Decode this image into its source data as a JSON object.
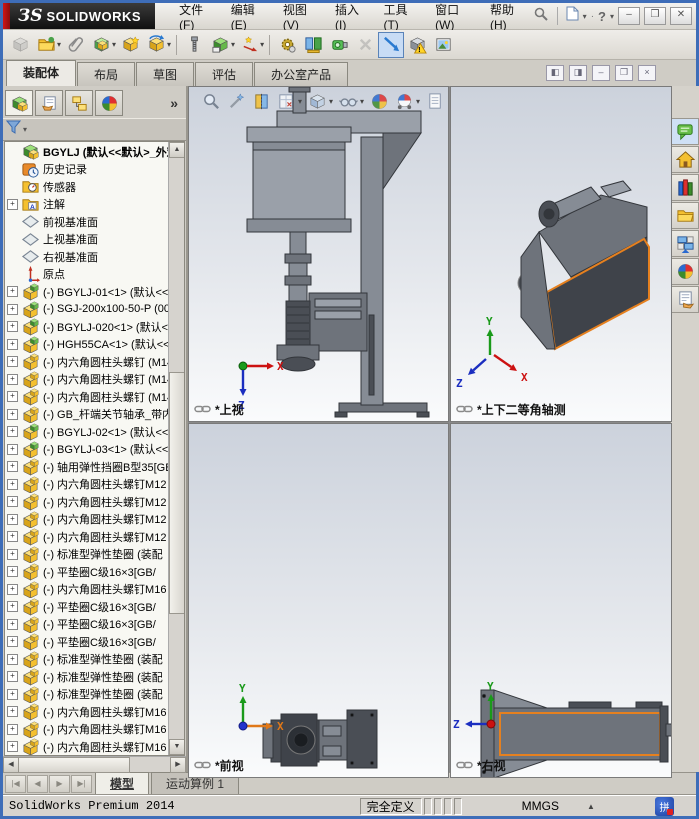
{
  "titlebar": {
    "brand_glyph": "ЗS",
    "brand_name": "SOLIDWORKS",
    "menus": [
      "文件(F)",
      "编辑(E)",
      "视图(V)",
      "插入(I)",
      "工具(T)",
      "窗口(W)",
      "帮助(H)"
    ],
    "window_buttons": {
      "minimize": "–",
      "restore": "❒",
      "close": "✕"
    }
  },
  "toolbar": {
    "items": [
      {
        "name": "insert-component",
        "icon": "cubegray",
        "grayed": true
      },
      {
        "name": "open-document",
        "icon": "folder",
        "dropdown": true
      },
      {
        "name": "attachment",
        "icon": "clip"
      },
      {
        "name": "mate",
        "icon": "pair",
        "dropdown": true
      },
      {
        "name": "insert-components",
        "icon": "starcube"
      },
      {
        "name": "rotate-component",
        "icon": "rotate",
        "dropdown": true,
        "sep_after": true
      },
      {
        "name": "smart-fasteners",
        "icon": "bolt"
      },
      {
        "name": "external-references",
        "icon": "cubegreen",
        "dropdown": true
      },
      {
        "name": "move-component",
        "icon": "movestar",
        "dropdown": true,
        "sep_after": true
      },
      {
        "name": "assembly-features",
        "icon": "gear"
      },
      {
        "name": "reference-geometry",
        "icon": "panels"
      },
      {
        "name": "new-motion-study",
        "icon": "motor"
      },
      {
        "name": "disabled-tool",
        "icon": "xgray",
        "grayed": true
      },
      {
        "name": "large-design-review",
        "icon": "bluearrow",
        "pressed": true
      },
      {
        "name": "interference-detection",
        "icon": "warncube"
      },
      {
        "name": "take-snapshot",
        "icon": "photo"
      }
    ]
  },
  "command_tabs": {
    "tabs": [
      "装配体",
      "布局",
      "草图",
      "评估",
      "办公室产品"
    ],
    "active_index": 0
  },
  "doc_controls": [
    "pane-left",
    "pane-right",
    "minimize",
    "restore",
    "close"
  ],
  "feature_panel": {
    "tabs": [
      "featuremanager",
      "propertymanager",
      "configurationmanager",
      "displaymanager"
    ],
    "active_tab_index": 0,
    "overflow_chevron": "»",
    "tree": [
      {
        "icon": "asmroot",
        "label": "BGYLJ (默认<<默认>_外观 显",
        "root": true
      },
      {
        "icon": "history",
        "label": "历史记录"
      },
      {
        "icon": "sensors",
        "label": "传感器"
      },
      {
        "icon": "ann",
        "label": "注解",
        "expand": true
      },
      {
        "icon": "plane",
        "label": "前视基准面"
      },
      {
        "icon": "plane",
        "label": "上视基准面"
      },
      {
        "icon": "plane",
        "label": "右视基准面"
      },
      {
        "icon": "origin",
        "label": "原点"
      },
      {
        "icon": "subasm",
        "label": "(-) BGYLJ-01<1> (默认<<默",
        "expand": true
      },
      {
        "icon": "subasm",
        "label": "(-) SGJ-200x100-50-P (00",
        "expand": true
      },
      {
        "icon": "subasm",
        "label": "(-) BGYLJ-020<1> (默认<",
        "expand": true
      },
      {
        "icon": "subasm",
        "label": "(-) HGH55CA<1> (默认<<默",
        "expand": true
      },
      {
        "icon": "part",
        "label": "(-) 内六角圆柱头螺钉 (M14",
        "expand": true
      },
      {
        "icon": "part",
        "label": "(-) 内六角圆柱头螺钉 (M14",
        "expand": true
      },
      {
        "icon": "part",
        "label": "(-) 内六角圆柱头螺钉 (M14",
        "expand": true
      },
      {
        "icon": "part",
        "label": "(-) GB_杆端关节轴承_带内",
        "expand": true
      },
      {
        "icon": "subasm",
        "label": "(-) BGYLJ-02<1> (默认<<",
        "expand": true
      },
      {
        "icon": "subasm",
        "label": "(-) BGYLJ-03<1> (默认<<",
        "expand": true
      },
      {
        "icon": "part",
        "label": "(-) 轴用弹性挡圈B型35[GB",
        "expand": true
      },
      {
        "icon": "part",
        "label": "(-) 内六角圆柱头螺钉M12",
        "expand": true
      },
      {
        "icon": "part",
        "label": "(-) 内六角圆柱头螺钉M12",
        "expand": true
      },
      {
        "icon": "part",
        "label": "(-) 内六角圆柱头螺钉M12",
        "expand": true
      },
      {
        "icon": "part",
        "label": "(-) 内六角圆柱头螺钉M12",
        "expand": true
      },
      {
        "icon": "part",
        "label": "(-) 标准型弹性垫圈 (装配",
        "expand": true
      },
      {
        "icon": "part",
        "label": "(-) 平垫圈C级16×3[GB/",
        "expand": true
      },
      {
        "icon": "part",
        "label": "(-) 内六角圆柱头螺钉M16",
        "expand": true
      },
      {
        "icon": "part",
        "label": "(-) 平垫圈C级16×3[GB/",
        "expand": true
      },
      {
        "icon": "part",
        "label": "(-) 平垫圈C级16×3[GB/",
        "expand": true
      },
      {
        "icon": "part",
        "label": "(-) 平垫圈C级16×3[GB/",
        "expand": true
      },
      {
        "icon": "part",
        "label": "(-) 标准型弹性垫圈 (装配",
        "expand": true
      },
      {
        "icon": "part",
        "label": "(-) 标准型弹性垫圈 (装配",
        "expand": true
      },
      {
        "icon": "part",
        "label": "(-) 标准型弹性垫圈 (装配",
        "expand": true
      },
      {
        "icon": "part",
        "label": "(-) 内六角圆柱头螺钉M16",
        "expand": true
      },
      {
        "icon": "part",
        "label": "(-) 内六角圆柱头螺钉M16",
        "expand": true
      },
      {
        "icon": "part",
        "label": "(-) 内六角圆柱头螺钉M16",
        "expand": true
      }
    ]
  },
  "heads_up": {
    "items": [
      {
        "name": "zoom-to-fit",
        "icon": "magnifier"
      },
      {
        "name": "zoom-to-area",
        "icon": "wand"
      },
      {
        "name": "section-view",
        "icon": "section"
      },
      {
        "name": "view-orientation",
        "icon": "sheet",
        "dropdown": true
      },
      {
        "name": "display-style",
        "icon": "cubeol",
        "dropdown": true
      },
      {
        "name": "hide-show-items",
        "icon": "glasses",
        "dropdown": true
      },
      {
        "name": "edit-appearance",
        "icon": "sphere"
      },
      {
        "name": "apply-scene",
        "icon": "sphere2",
        "dropdown": true
      },
      {
        "name": "view-settings",
        "icon": "page"
      }
    ]
  },
  "viewports": [
    {
      "label": "*上视",
      "axis_labels": [
        "X",
        "Z"
      ]
    },
    {
      "label": "*上下二等角轴测",
      "axis_labels": [
        "Y",
        "X",
        "Z"
      ]
    },
    {
      "label": "*前视",
      "axis_labels": [
        "Y",
        "X"
      ]
    },
    {
      "label": "*右视",
      "axis_labels": [
        "Y",
        "Z"
      ]
    }
  ],
  "task_pane": {
    "items": [
      {
        "name": "solidworks-resources",
        "icon": "chat",
        "active": true
      },
      {
        "name": "home",
        "icon": "home"
      },
      {
        "name": "design-library",
        "icon": "books"
      },
      {
        "name": "file-explorer",
        "icon": "folder2"
      },
      {
        "name": "view-palette",
        "icon": "palette"
      },
      {
        "name": "appearances-scenes",
        "icon": "sphere"
      },
      {
        "name": "custom-properties",
        "icon": "handpage"
      }
    ]
  },
  "bottom_tabs": {
    "nav": [
      "|◀",
      "◀",
      "▶",
      "▶|"
    ],
    "tabs": [
      "模型",
      "运动算例 1"
    ],
    "active_index": 0
  },
  "status_bar": {
    "app_version": "SolidWorks Premium 2014",
    "define_state": "完全定义",
    "units": "MMGS",
    "units_arrow": "▲",
    "ime": "拼"
  }
}
